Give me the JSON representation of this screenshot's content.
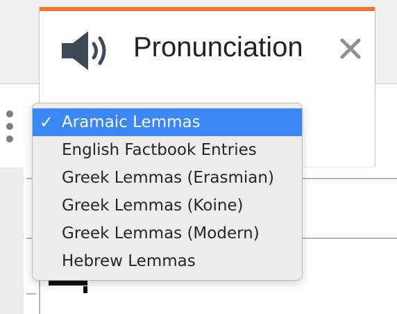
{
  "tab": {
    "title": "Pronunciation",
    "icon": "speaker-icon",
    "close_icon": "close-icon",
    "accent_color": "#f0752f"
  },
  "dropdown": {
    "selected_index": 0,
    "checkmark": "✓",
    "items": [
      {
        "label": "Aramaic Lemmas",
        "selected": true
      },
      {
        "label": "English Factbook Entries",
        "selected": false
      },
      {
        "label": "Greek Lemmas (Erasmian)",
        "selected": false
      },
      {
        "label": "Greek Lemmas (Koine)",
        "selected": false
      },
      {
        "label": "Greek Lemmas (Modern)",
        "selected": false
      },
      {
        "label": "Hebrew Lemmas",
        "selected": false
      }
    ],
    "highlight_color": "#3b86f5"
  },
  "side_menu": {
    "icon": "kebab-menu-icon"
  }
}
